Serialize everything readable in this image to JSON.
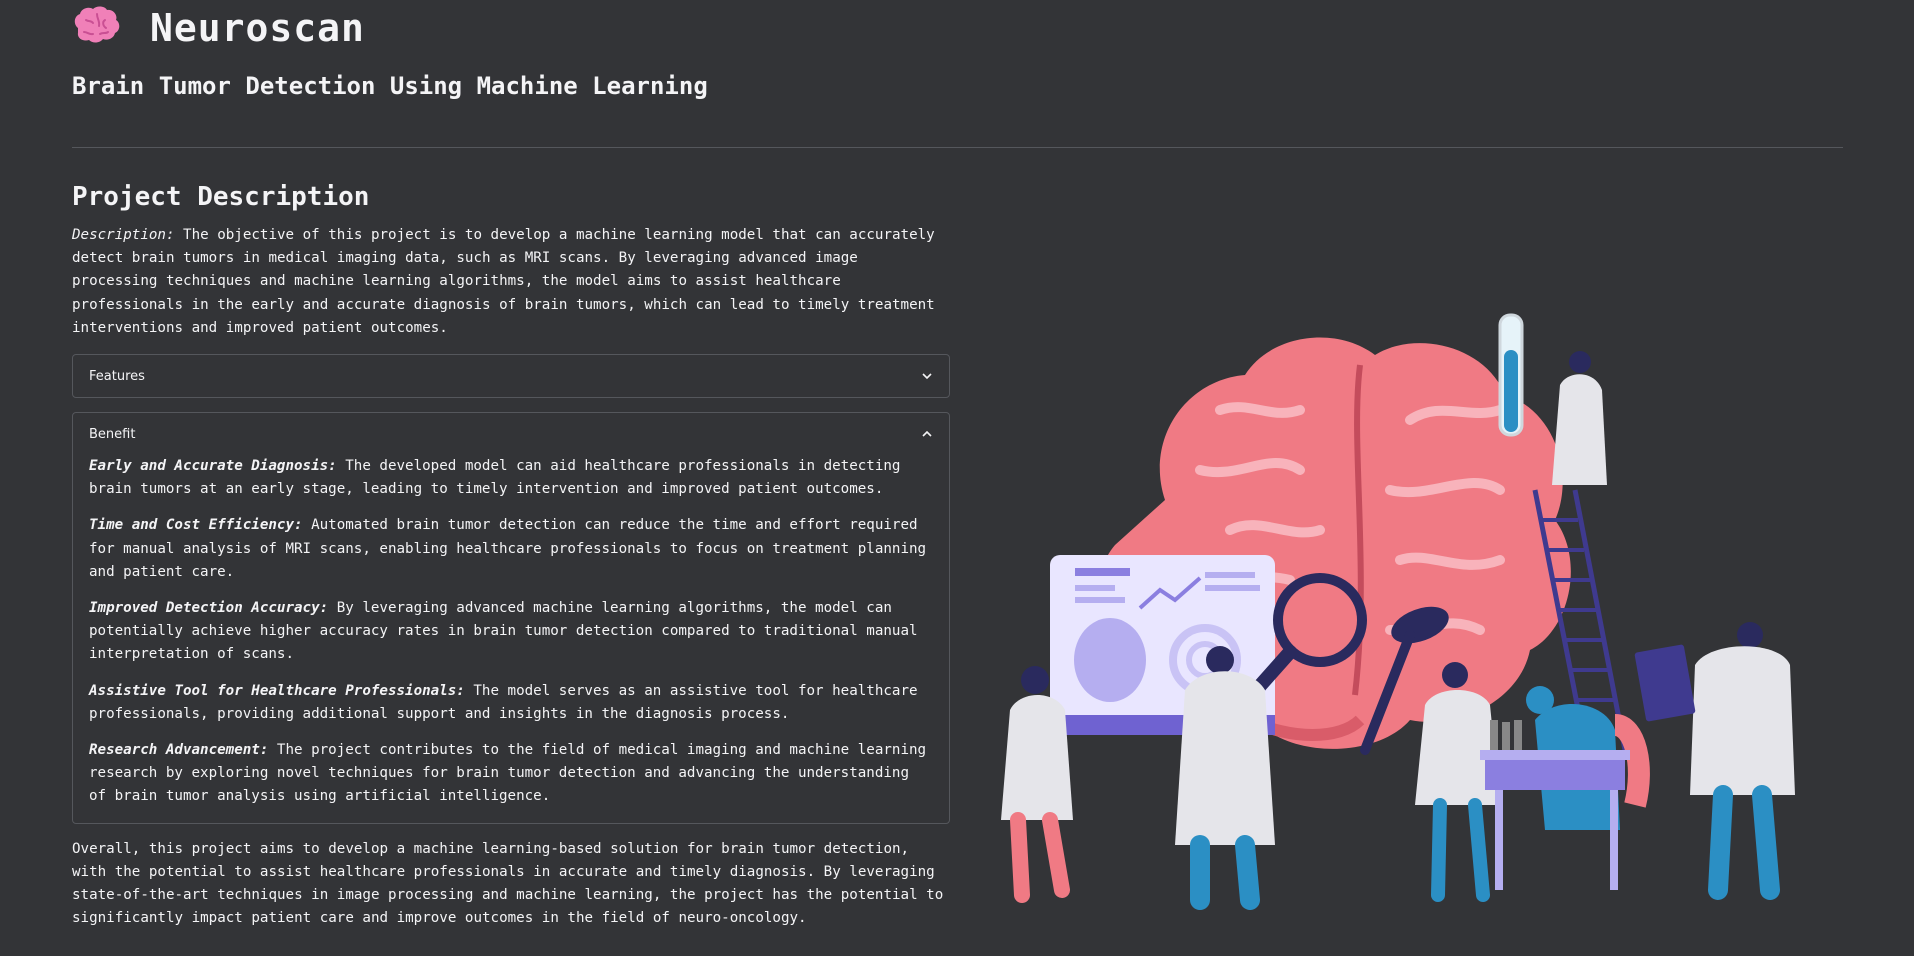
{
  "header": {
    "title": "Neuroscan",
    "subtitle": "Brain Tumor Detection Using Machine Learning"
  },
  "project": {
    "heading": "Project Description",
    "description_label": "Description:",
    "description_text": " The objective of this project is to develop a machine learning model that can accurately detect brain tumors in medical imaging data, such as MRI scans. By leveraging advanced image processing techniques and machine learning algorithms, the model aims to assist healthcare professionals in the early and accurate diagnosis of brain tumors, which can lead to timely treatment interventions and improved patient outcomes."
  },
  "features": {
    "label": "Features",
    "state": "collapsed"
  },
  "benefit": {
    "label": "Benefit",
    "state": "expanded",
    "items": [
      {
        "title": "Early and Accurate Diagnosis:",
        "text": " The developed model can aid healthcare professionals in detecting brain tumors at an early stage, leading to timely intervention and improved patient outcomes."
      },
      {
        "title": "Time and Cost Efficiency:",
        "text": " Automated brain tumor detection can reduce the time and effort required for manual analysis of MRI scans, enabling healthcare professionals to focus on treatment planning and patient care."
      },
      {
        "title": "Improved Detection Accuracy:",
        "text": " By leveraging advanced machine learning algorithms, the model can potentially achieve higher accuracy rates in brain tumor detection compared to traditional manual interpretation of scans."
      },
      {
        "title": "Assistive Tool for Healthcare Professionals:",
        "text": " The model serves as an assistive tool for healthcare professionals, providing additional support and insights in the diagnosis process."
      },
      {
        "title": "Research Advancement:",
        "text": " The project contributes to the field of medical imaging and machine learning research by exploring novel techniques for brain tumor detection and advancing the understanding of brain tumor analysis using artificial intelligence."
      }
    ]
  },
  "overall_text": "Overall, this project aims to develop a machine learning-based solution for brain tumor detection, with the potential to assist healthcare professionals in accurate and timely diagnosis. By leveraging state-of-the-art techniques in image processing and machine learning, the project has the potential to significantly impact patient care and improve outcomes in the field of neuro-oncology.",
  "icons": {
    "logo": "brain-emoji-icon",
    "features_toggle": "chevron-down-icon",
    "benefit_toggle": "chevron-up-icon"
  },
  "illustration": "brain-research-illustration",
  "colors": {
    "background": "#333437",
    "text": "#f4f4f6",
    "divider": "#55575c",
    "brain": "#f07a84",
    "brain_dark": "#d95c69",
    "accent_purple": "#8b7fe0",
    "accent_blue": "#2b8fc4"
  }
}
